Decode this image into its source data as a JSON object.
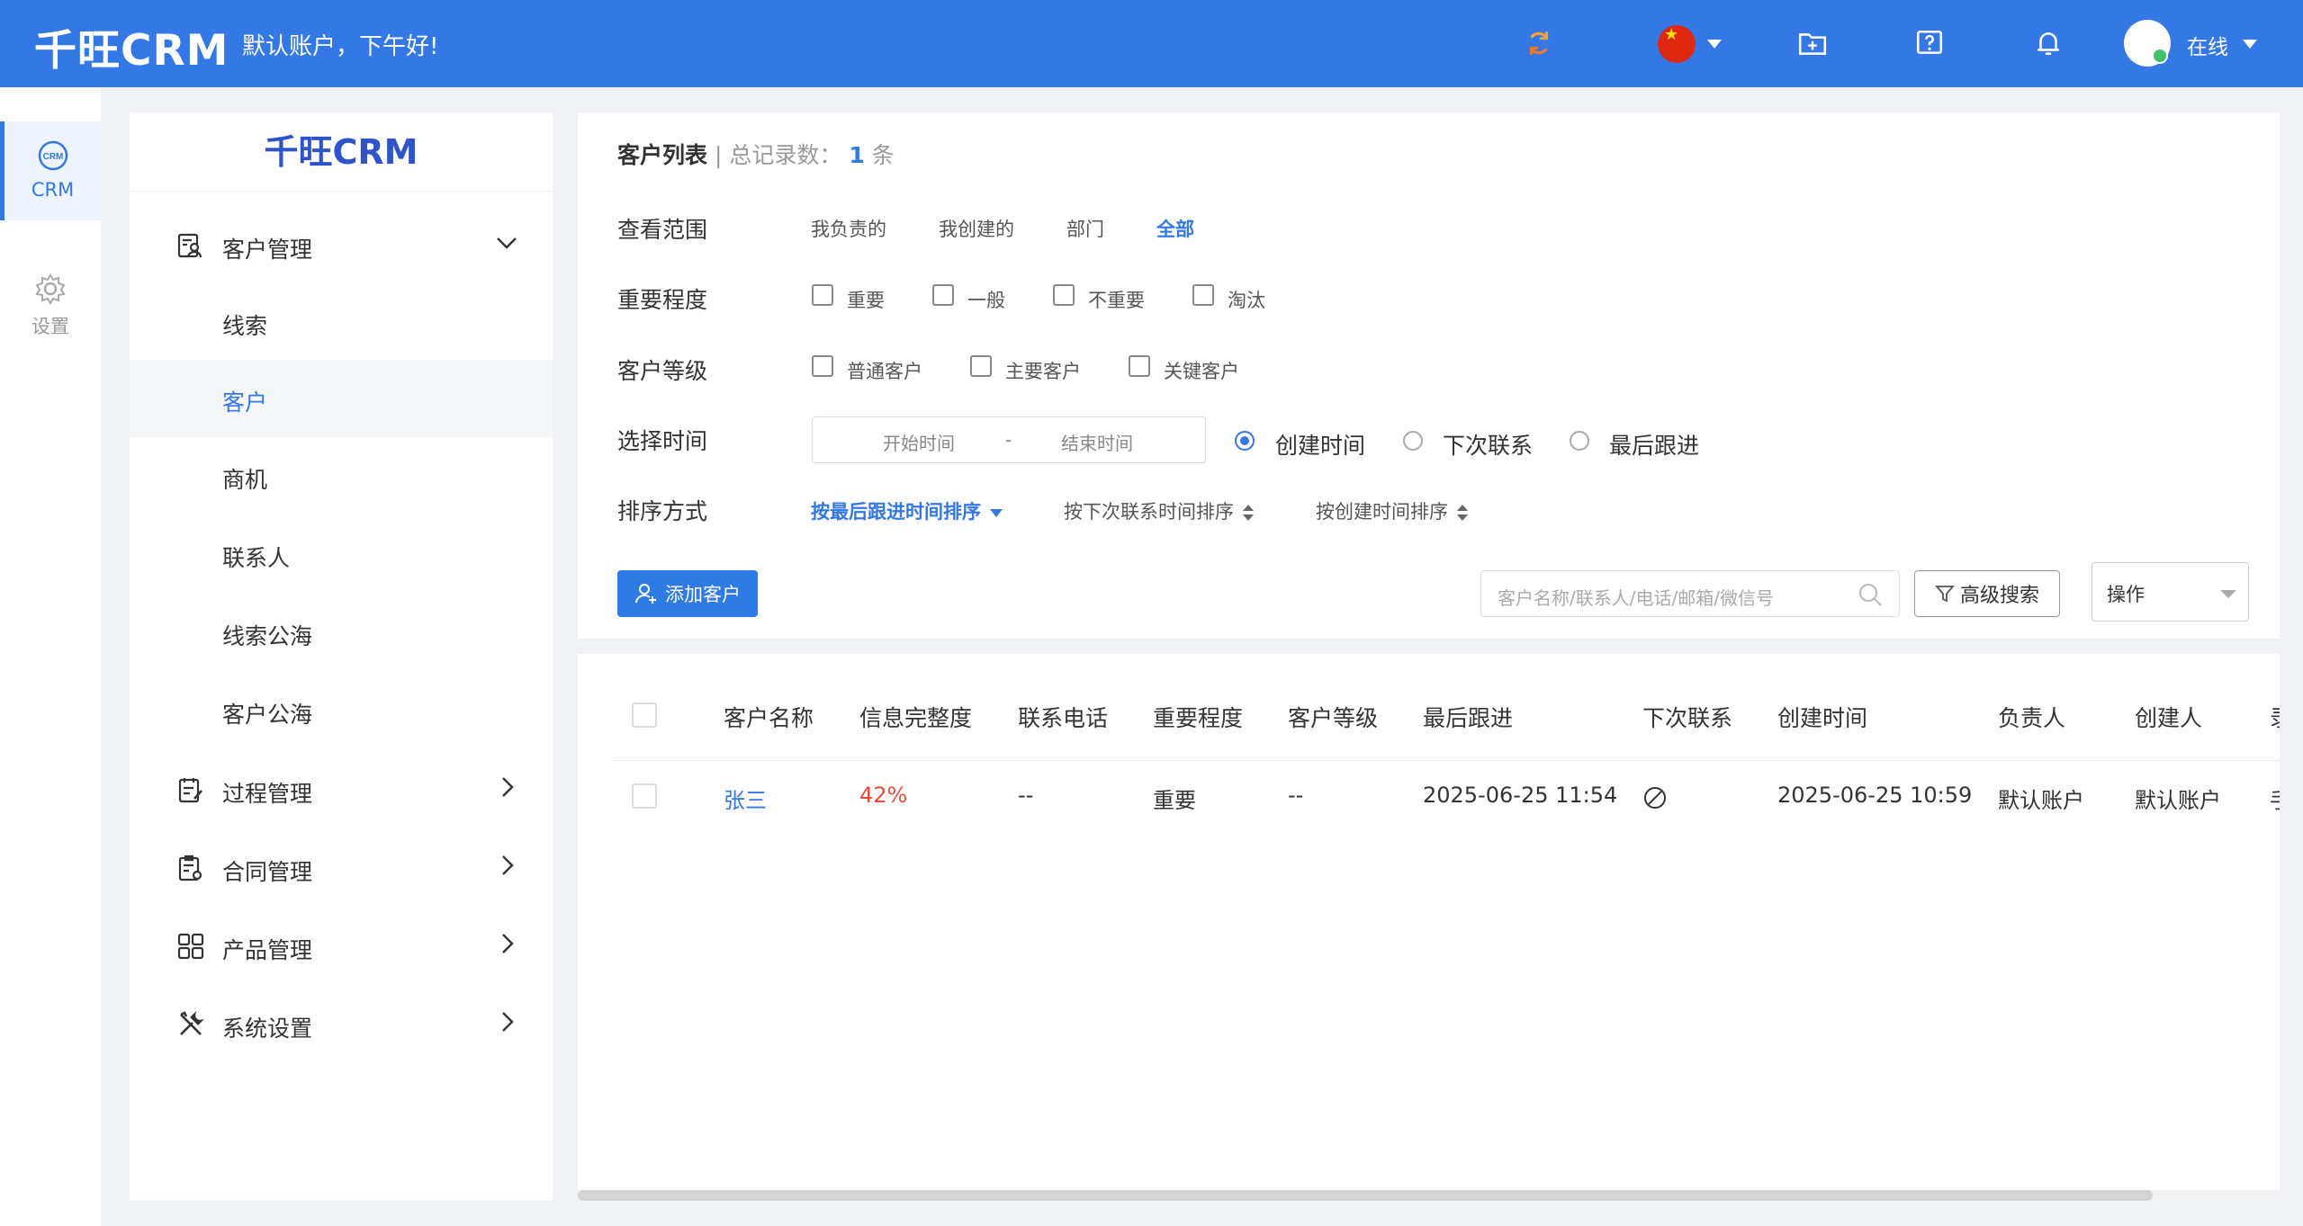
{
  "header": {
    "logo": "千旺CRM",
    "greeting": "默认账户，下午好!",
    "user_status": "在线",
    "icons": [
      "sync-icon",
      "china-flag-icon",
      "add-folder-icon",
      "help-icon",
      "bell-icon"
    ],
    "brand_color": "#3478e5"
  },
  "rail": {
    "items": [
      {
        "label": "CRM",
        "icon": "crm-icon",
        "active": true
      },
      {
        "label": "设置",
        "icon": "gear-icon",
        "active": false
      }
    ]
  },
  "nav": {
    "title": "千旺CRM",
    "items": [
      {
        "label": "客户管理",
        "icon": "customer-manage-icon",
        "expanded": true
      },
      {
        "label": "线索"
      },
      {
        "label": "客户",
        "selected": true
      },
      {
        "label": "商机"
      },
      {
        "label": "联系人"
      },
      {
        "label": "线索公海"
      },
      {
        "label": "客户公海"
      },
      {
        "label": "过程管理",
        "icon": "process-icon"
      },
      {
        "label": "合同管理",
        "icon": "contract-icon"
      },
      {
        "label": "产品管理",
        "icon": "product-icon"
      },
      {
        "label": "系统设置",
        "icon": "tools-icon"
      }
    ]
  },
  "main": {
    "title": "客户列表",
    "total_prefix": "总记录数：",
    "total_count": "1",
    "total_suffix": "条",
    "filters": {
      "scope": {
        "label": "查看范围",
        "options": [
          "我负责的",
          "我创建的",
          "部门",
          "全部"
        ],
        "selected": "全部"
      },
      "importance": {
        "label": "重要程度",
        "options": [
          "重要",
          "一般",
          "不重要",
          "淘汰"
        ]
      },
      "level": {
        "label": "客户等级",
        "options": [
          "普通客户",
          "主要客户",
          "关键客户"
        ]
      },
      "time": {
        "label": "选择时间",
        "start_placeholder": "开始时间",
        "separator": "-",
        "end_placeholder": "结束时间",
        "radios": [
          "创建时间",
          "下次联系",
          "最后跟进"
        ],
        "selected": "创建时间"
      },
      "sort": {
        "label": "排序方式",
        "options": [
          "按最后跟进时间排序",
          "按下次联系时间排序",
          "按创建时间排序"
        ],
        "selected": "按最后跟进时间排序"
      }
    },
    "add_button": "添加客户",
    "search_placeholder": "客户名称/联系人/电话/邮箱/微信号",
    "advanced_search": "高级搜索",
    "operation_select": "操作"
  },
  "table": {
    "columns": [
      "客户名称",
      "信息完整度",
      "联系电话",
      "重要程度",
      "客户等级",
      "最后跟进",
      "下次联系",
      "创建时间",
      "负责人",
      "创建人",
      "录"
    ],
    "rows": [
      {
        "name": "张三",
        "completeness": "42%",
        "phone": "--",
        "importance": "重要",
        "level": "--",
        "last_follow": "2025-06-25 11:54",
        "next_contact_icon": "no-entry-icon",
        "created": "2025-06-25 10:59",
        "owner": "默认账户",
        "creator": "默认账户",
        "extra": "手"
      }
    ],
    "link_color": "#3478e5",
    "percent_color": "#e84b3c"
  }
}
